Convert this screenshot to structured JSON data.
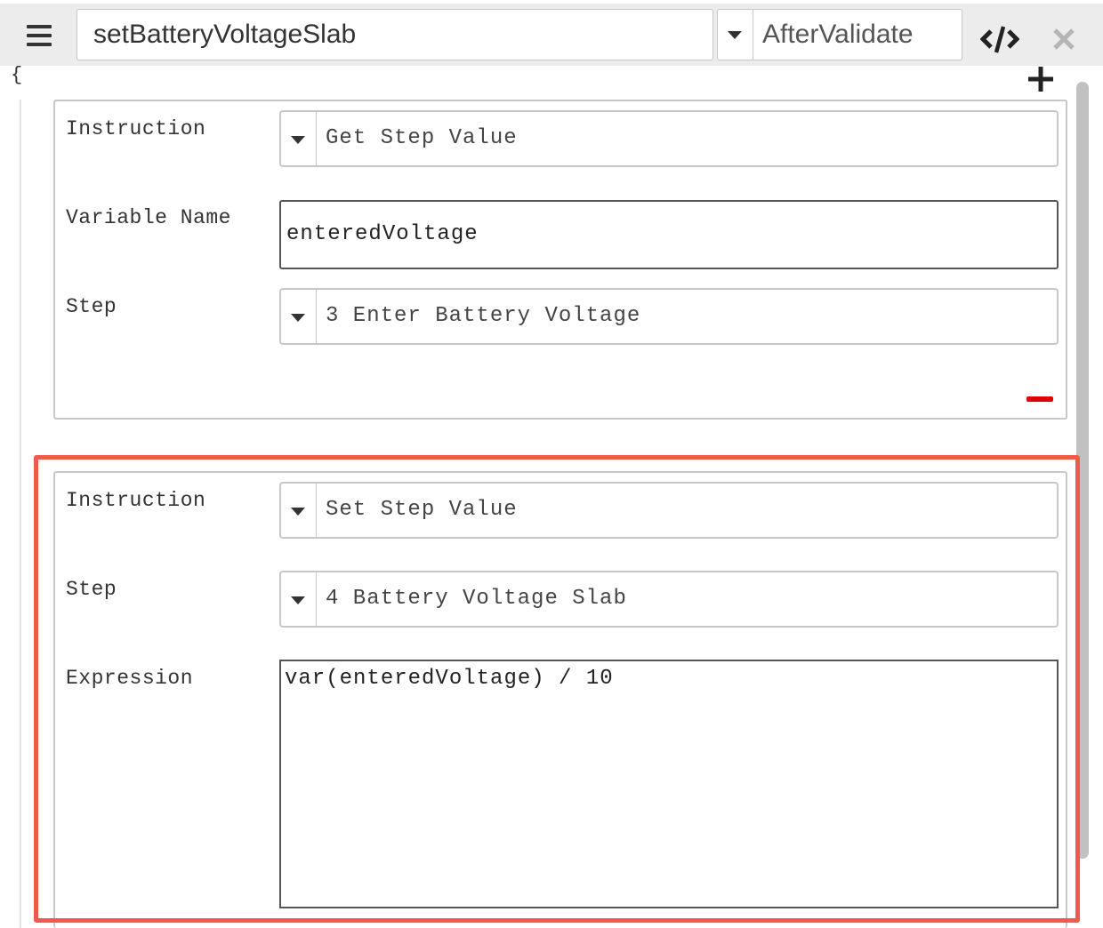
{
  "toolbar": {
    "rule_name": "setBatteryVoltageSlab",
    "event": "AfterValidate"
  },
  "editor": {
    "open_brace": "{"
  },
  "instructions": [
    {
      "fields": [
        {
          "label": "Instruction",
          "type": "select",
          "value": "Get Step Value"
        },
        {
          "label": "Variable Name",
          "type": "text",
          "value": "enteredVoltage"
        },
        {
          "label": "Step",
          "type": "select",
          "value": "3 Enter Battery Voltage"
        }
      ]
    },
    {
      "fields": [
        {
          "label": "Instruction",
          "type": "select",
          "value": "Set Step Value"
        },
        {
          "label": "Step",
          "type": "select",
          "value": "4 Battery Voltage Slab"
        },
        {
          "label": "Expression",
          "type": "textarea",
          "value": "var(enteredVoltage) / 10"
        }
      ]
    }
  ],
  "colors": {
    "highlight": "#f05a4a",
    "remove": "#e00000"
  }
}
